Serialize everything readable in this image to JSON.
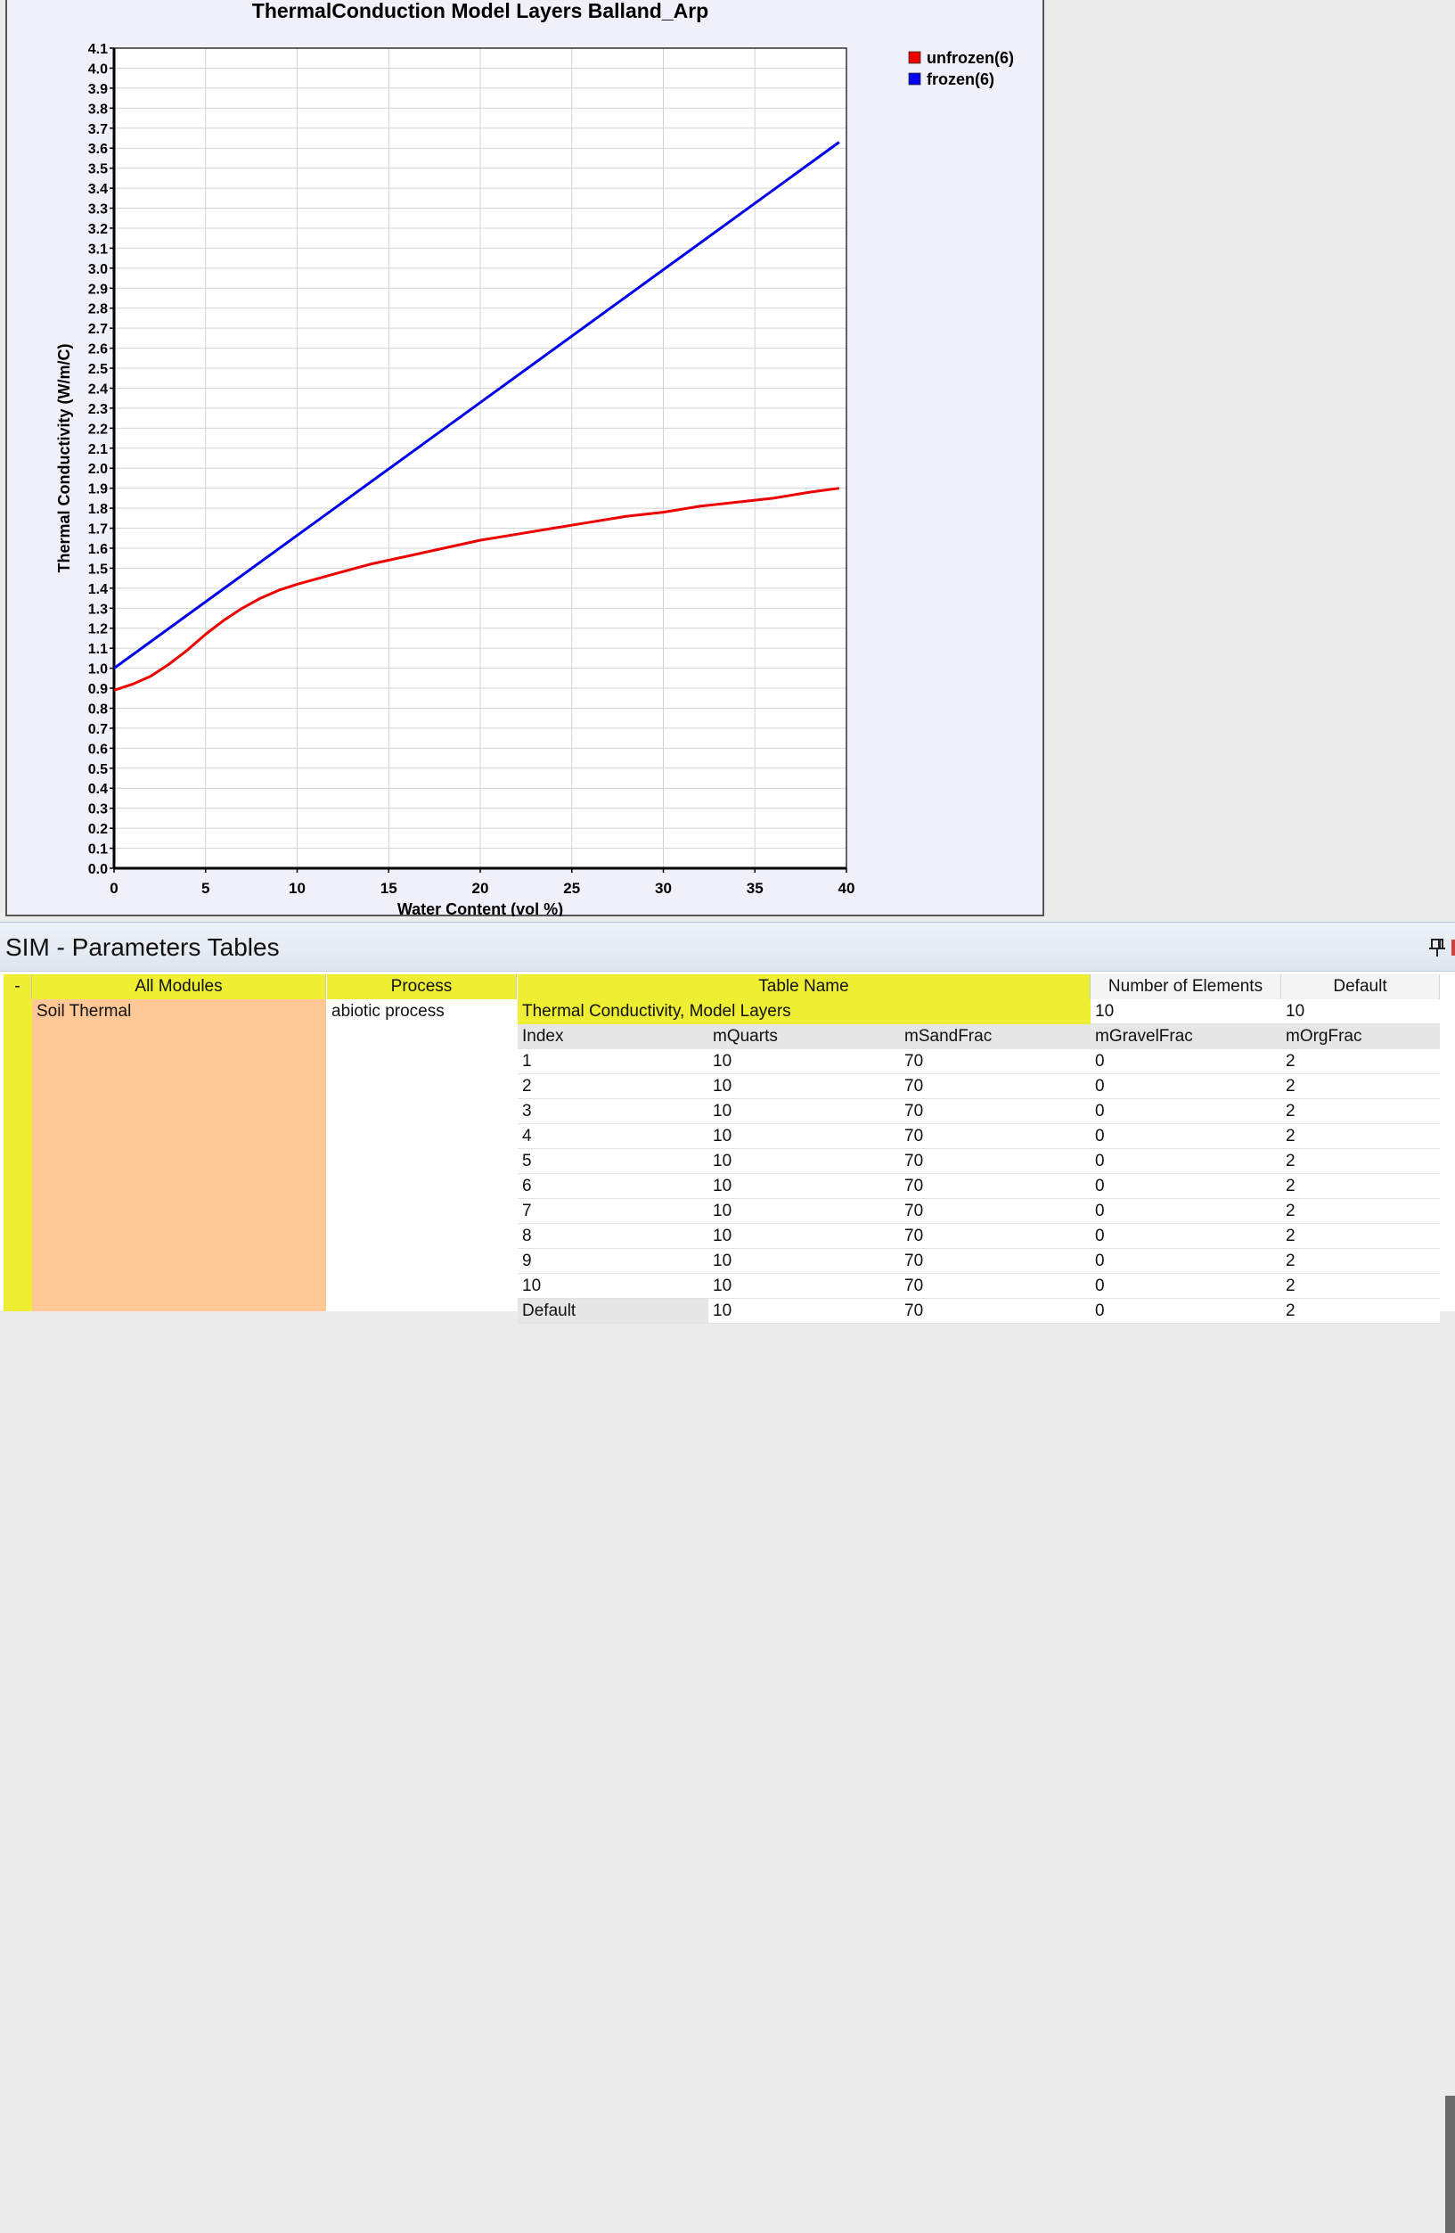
{
  "chart_data": {
    "type": "line",
    "title": "ThermalConduction Model Layers Balland_Arp",
    "xlabel": "Water Content (vol %)",
    "ylabel": "Thermal Conductivity (W/m/C)",
    "xlim": [
      0,
      40
    ],
    "ylim": [
      0,
      4.1
    ],
    "x_ticks": [
      0,
      5,
      10,
      15,
      20,
      25,
      30,
      35,
      40
    ],
    "y_tick_step": 0.1,
    "grid": true,
    "legend_position": "top-right-outside",
    "series": [
      {
        "name": "unfrozen(6)",
        "color": "#ee0000",
        "x": [
          0,
          1,
          2,
          3,
          4,
          5,
          6,
          7,
          8,
          9,
          10,
          12,
          14,
          16,
          18,
          20,
          22,
          24,
          26,
          28,
          30,
          32,
          34,
          36,
          38,
          39.6
        ],
        "y": [
          0.89,
          0.92,
          0.96,
          1.02,
          1.09,
          1.17,
          1.24,
          1.3,
          1.35,
          1.39,
          1.42,
          1.47,
          1.52,
          1.56,
          1.6,
          1.64,
          1.67,
          1.7,
          1.73,
          1.76,
          1.78,
          1.81,
          1.83,
          1.85,
          1.88,
          1.9
        ]
      },
      {
        "name": "frozen(6)",
        "color": "#0000ee",
        "x": [
          0,
          39.6
        ],
        "y": [
          1.0,
          3.63
        ]
      }
    ]
  },
  "panel": {
    "title": "SIM - Parameters Tables",
    "pin_icon": "pin-icon"
  },
  "table": {
    "headers": {
      "toggle": "-",
      "all_modules": "All Modules",
      "process": "Process",
      "table_name": "Table Name",
      "num_elements": "Number of Elements",
      "default": "Default"
    },
    "row": {
      "module": "Soil Thermal",
      "process": "abiotic process",
      "table_name": "Thermal Conductivity, Model Layers",
      "num_elements": "10",
      "default": "10"
    },
    "columns": [
      "Index",
      "mQuarts",
      "mSandFrac",
      "mGravelFrac",
      "mOrgFrac"
    ],
    "rows": [
      [
        "1",
        "10",
        "70",
        "0",
        "2"
      ],
      [
        "2",
        "10",
        "70",
        "0",
        "2"
      ],
      [
        "3",
        "10",
        "70",
        "0",
        "2"
      ],
      [
        "4",
        "10",
        "70",
        "0",
        "2"
      ],
      [
        "5",
        "10",
        "70",
        "0",
        "2"
      ],
      [
        "6",
        "10",
        "70",
        "0",
        "2"
      ],
      [
        "7",
        "10",
        "70",
        "0",
        "2"
      ],
      [
        "8",
        "10",
        "70",
        "0",
        "2"
      ],
      [
        "9",
        "10",
        "70",
        "0",
        "2"
      ],
      [
        "10",
        "10",
        "70",
        "0",
        "2"
      ],
      [
        "Default",
        "10",
        "70",
        "0",
        "2"
      ]
    ]
  },
  "colors": {
    "header_yellow": "#eeee33",
    "module_orange": "#ffc896",
    "chart_bg": "#f0f0fb"
  }
}
